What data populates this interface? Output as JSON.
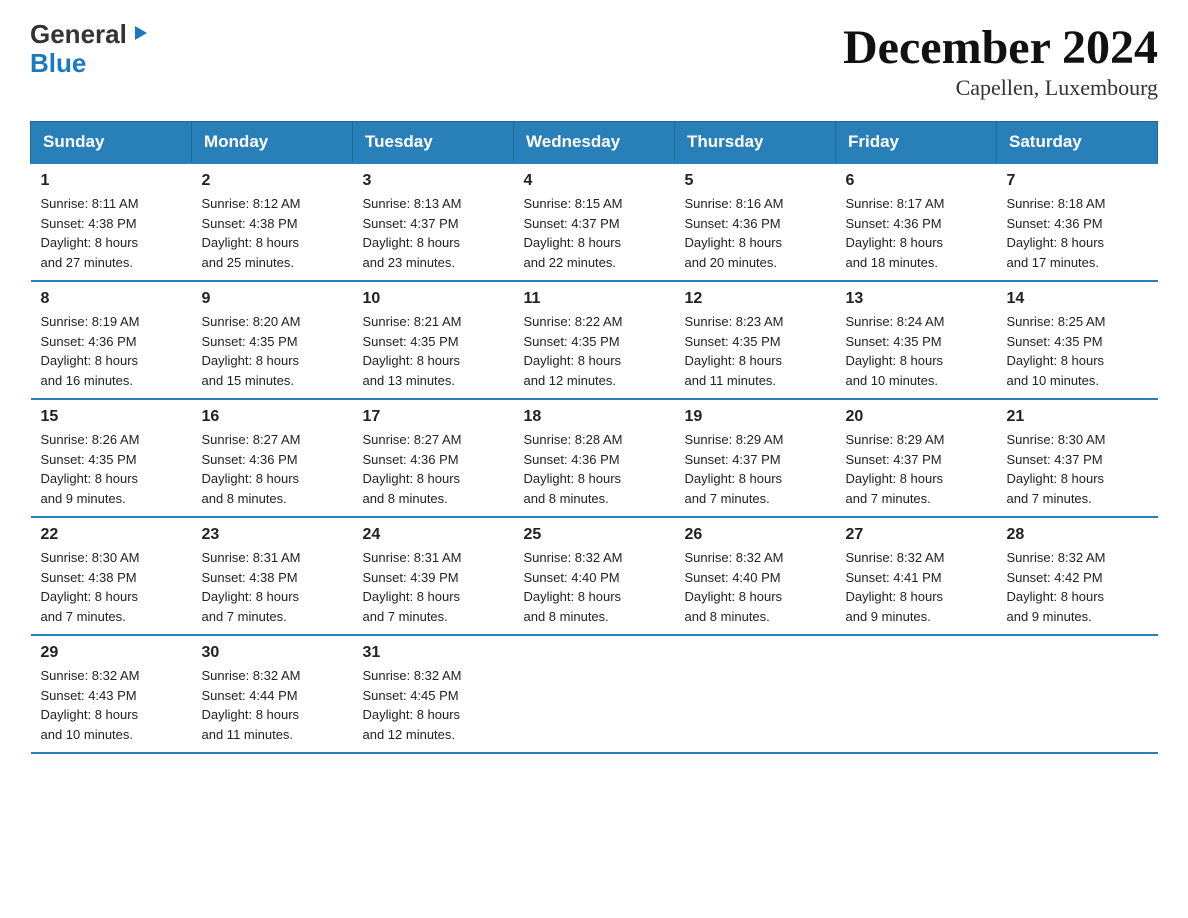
{
  "header": {
    "logo_general": "General",
    "logo_blue": "Blue",
    "title": "December 2024",
    "subtitle": "Capellen, Luxembourg"
  },
  "days_of_week": [
    "Sunday",
    "Monday",
    "Tuesday",
    "Wednesday",
    "Thursday",
    "Friday",
    "Saturday"
  ],
  "weeks": [
    [
      {
        "num": "1",
        "sunrise": "8:11 AM",
        "sunset": "4:38 PM",
        "daylight_hours": "8",
        "daylight_minutes": "27"
      },
      {
        "num": "2",
        "sunrise": "8:12 AM",
        "sunset": "4:38 PM",
        "daylight_hours": "8",
        "daylight_minutes": "25"
      },
      {
        "num": "3",
        "sunrise": "8:13 AM",
        "sunset": "4:37 PM",
        "daylight_hours": "8",
        "daylight_minutes": "23"
      },
      {
        "num": "4",
        "sunrise": "8:15 AM",
        "sunset": "4:37 PM",
        "daylight_hours": "8",
        "daylight_minutes": "22"
      },
      {
        "num": "5",
        "sunrise": "8:16 AM",
        "sunset": "4:36 PM",
        "daylight_hours": "8",
        "daylight_minutes": "20"
      },
      {
        "num": "6",
        "sunrise": "8:17 AM",
        "sunset": "4:36 PM",
        "daylight_hours": "8",
        "daylight_minutes": "18"
      },
      {
        "num": "7",
        "sunrise": "8:18 AM",
        "sunset": "4:36 PM",
        "daylight_hours": "8",
        "daylight_minutes": "17"
      }
    ],
    [
      {
        "num": "8",
        "sunrise": "8:19 AM",
        "sunset": "4:36 PM",
        "daylight_hours": "8",
        "daylight_minutes": "16"
      },
      {
        "num": "9",
        "sunrise": "8:20 AM",
        "sunset": "4:35 PM",
        "daylight_hours": "8",
        "daylight_minutes": "15"
      },
      {
        "num": "10",
        "sunrise": "8:21 AM",
        "sunset": "4:35 PM",
        "daylight_hours": "8",
        "daylight_minutes": "13"
      },
      {
        "num": "11",
        "sunrise": "8:22 AM",
        "sunset": "4:35 PM",
        "daylight_hours": "8",
        "daylight_minutes": "12"
      },
      {
        "num": "12",
        "sunrise": "8:23 AM",
        "sunset": "4:35 PM",
        "daylight_hours": "8",
        "daylight_minutes": "11"
      },
      {
        "num": "13",
        "sunrise": "8:24 AM",
        "sunset": "4:35 PM",
        "daylight_hours": "8",
        "daylight_minutes": "10"
      },
      {
        "num": "14",
        "sunrise": "8:25 AM",
        "sunset": "4:35 PM",
        "daylight_hours": "8",
        "daylight_minutes": "10"
      }
    ],
    [
      {
        "num": "15",
        "sunrise": "8:26 AM",
        "sunset": "4:35 PM",
        "daylight_hours": "8",
        "daylight_minutes": "9"
      },
      {
        "num": "16",
        "sunrise": "8:27 AM",
        "sunset": "4:36 PM",
        "daylight_hours": "8",
        "daylight_minutes": "8"
      },
      {
        "num": "17",
        "sunrise": "8:27 AM",
        "sunset": "4:36 PM",
        "daylight_hours": "8",
        "daylight_minutes": "8"
      },
      {
        "num": "18",
        "sunrise": "8:28 AM",
        "sunset": "4:36 PM",
        "daylight_hours": "8",
        "daylight_minutes": "8"
      },
      {
        "num": "19",
        "sunrise": "8:29 AM",
        "sunset": "4:37 PM",
        "daylight_hours": "8",
        "daylight_minutes": "7"
      },
      {
        "num": "20",
        "sunrise": "8:29 AM",
        "sunset": "4:37 PM",
        "daylight_hours": "8",
        "daylight_minutes": "7"
      },
      {
        "num": "21",
        "sunrise": "8:30 AM",
        "sunset": "4:37 PM",
        "daylight_hours": "8",
        "daylight_minutes": "7"
      }
    ],
    [
      {
        "num": "22",
        "sunrise": "8:30 AM",
        "sunset": "4:38 PM",
        "daylight_hours": "8",
        "daylight_minutes": "7"
      },
      {
        "num": "23",
        "sunrise": "8:31 AM",
        "sunset": "4:38 PM",
        "daylight_hours": "8",
        "daylight_minutes": "7"
      },
      {
        "num": "24",
        "sunrise": "8:31 AM",
        "sunset": "4:39 PM",
        "daylight_hours": "8",
        "daylight_minutes": "7"
      },
      {
        "num": "25",
        "sunrise": "8:32 AM",
        "sunset": "4:40 PM",
        "daylight_hours": "8",
        "daylight_minutes": "8"
      },
      {
        "num": "26",
        "sunrise": "8:32 AM",
        "sunset": "4:40 PM",
        "daylight_hours": "8",
        "daylight_minutes": "8"
      },
      {
        "num": "27",
        "sunrise": "8:32 AM",
        "sunset": "4:41 PM",
        "daylight_hours": "8",
        "daylight_minutes": "9"
      },
      {
        "num": "28",
        "sunrise": "8:32 AM",
        "sunset": "4:42 PM",
        "daylight_hours": "8",
        "daylight_minutes": "9"
      }
    ],
    [
      {
        "num": "29",
        "sunrise": "8:32 AM",
        "sunset": "4:43 PM",
        "daylight_hours": "8",
        "daylight_minutes": "10"
      },
      {
        "num": "30",
        "sunrise": "8:32 AM",
        "sunset": "4:44 PM",
        "daylight_hours": "8",
        "daylight_minutes": "11"
      },
      {
        "num": "31",
        "sunrise": "8:32 AM",
        "sunset": "4:45 PM",
        "daylight_hours": "8",
        "daylight_minutes": "12"
      },
      null,
      null,
      null,
      null
    ]
  ],
  "labels": {
    "sunrise": "Sunrise:",
    "sunset": "Sunset:",
    "daylight": "Daylight:",
    "hours_suffix": "hours",
    "and": "and",
    "minutes_suffix": "minutes."
  }
}
